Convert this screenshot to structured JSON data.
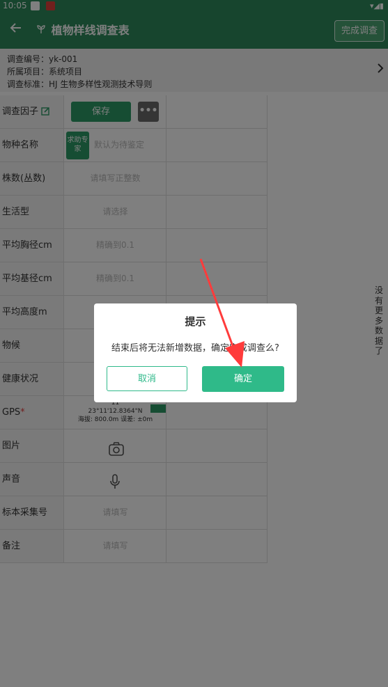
{
  "status_bar": {
    "time": "10:05",
    "right_icons": "▾◢▮"
  },
  "app_bar": {
    "back_icon": "arrow-left",
    "title": "植物样线调查表",
    "title_icon": "sprout-icon",
    "finish_label": "完成调查"
  },
  "info": {
    "survey_number": "调查编号：yk-001",
    "project": "所属项目：系统项目",
    "standard": "调查标准：HJ 生物多样性观测技术导则"
  },
  "form": {
    "factor": {
      "label": "调查因子",
      "save": "保存",
      "more": "•••"
    },
    "species": {
      "label": "物种名称",
      "expert": "求助专家",
      "placeholder": "默认为待鉴定"
    },
    "count": {
      "label": "株数(丛数)",
      "placeholder": "请填写正整数"
    },
    "lifeform": {
      "label": "生活型",
      "placeholder": "请选择"
    },
    "dbh": {
      "label": "平均胸径cm",
      "placeholder": "精确到0.1"
    },
    "basal": {
      "label": "平均基径cm",
      "placeholder": "精确到0.1"
    },
    "height": {
      "label": "平均高度m"
    },
    "phenology": {
      "label": "物候"
    },
    "health": {
      "label": "健康状况"
    },
    "gps": {
      "label": "GPS",
      "required": "*",
      "line1": "11",
      "line2": "23°11'12.8364\"N",
      "line3": "海拔: 800.0m  误差: ±0m"
    },
    "photo": {
      "label": "图片"
    },
    "sound": {
      "label": "声音"
    },
    "specimen": {
      "label": "标本采集号",
      "placeholder": "请填写"
    },
    "remark": {
      "label": "备注",
      "placeholder": "请填写"
    }
  },
  "right_hint": "没有更多数据了",
  "dialog": {
    "title": "提示",
    "message": "结束后将无法新增数据，确定完成调查么?",
    "cancel": "取消",
    "confirm": "确定"
  },
  "colors": {
    "primary": "#2e8b5d",
    "button": "#2d9a66",
    "confirm": "#2fba89",
    "arrow": "#ff3b3b"
  }
}
